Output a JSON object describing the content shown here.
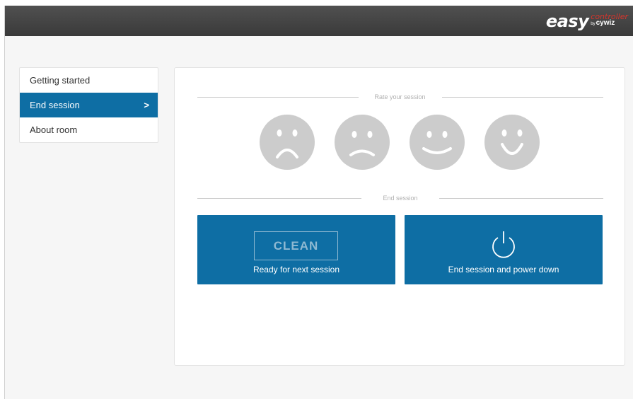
{
  "header": {
    "logo": {
      "word": "easy",
      "sub": "controller",
      "by": "by",
      "brand": "cywiz"
    }
  },
  "sidebar": {
    "items": [
      {
        "label": "Getting started",
        "active": false
      },
      {
        "label": "End session",
        "active": true,
        "indicator": ">"
      },
      {
        "label": "About room",
        "active": false
      }
    ]
  },
  "main": {
    "rate_label": "Rate your session",
    "ratings": [
      {
        "name": "very-sad-face-icon"
      },
      {
        "name": "sad-face-icon"
      },
      {
        "name": "happy-face-icon"
      },
      {
        "name": "very-happy-face-icon"
      }
    ],
    "end_label": "End session",
    "buttons": {
      "clean": {
        "badge": "CLEAN",
        "label": "Ready for next session"
      },
      "power": {
        "label": "End session and power down"
      }
    }
  },
  "colors": {
    "accent": "#0e6ea4",
    "topbar": "#444444",
    "face": "#cccccc",
    "logo_red": "#d6352c"
  }
}
